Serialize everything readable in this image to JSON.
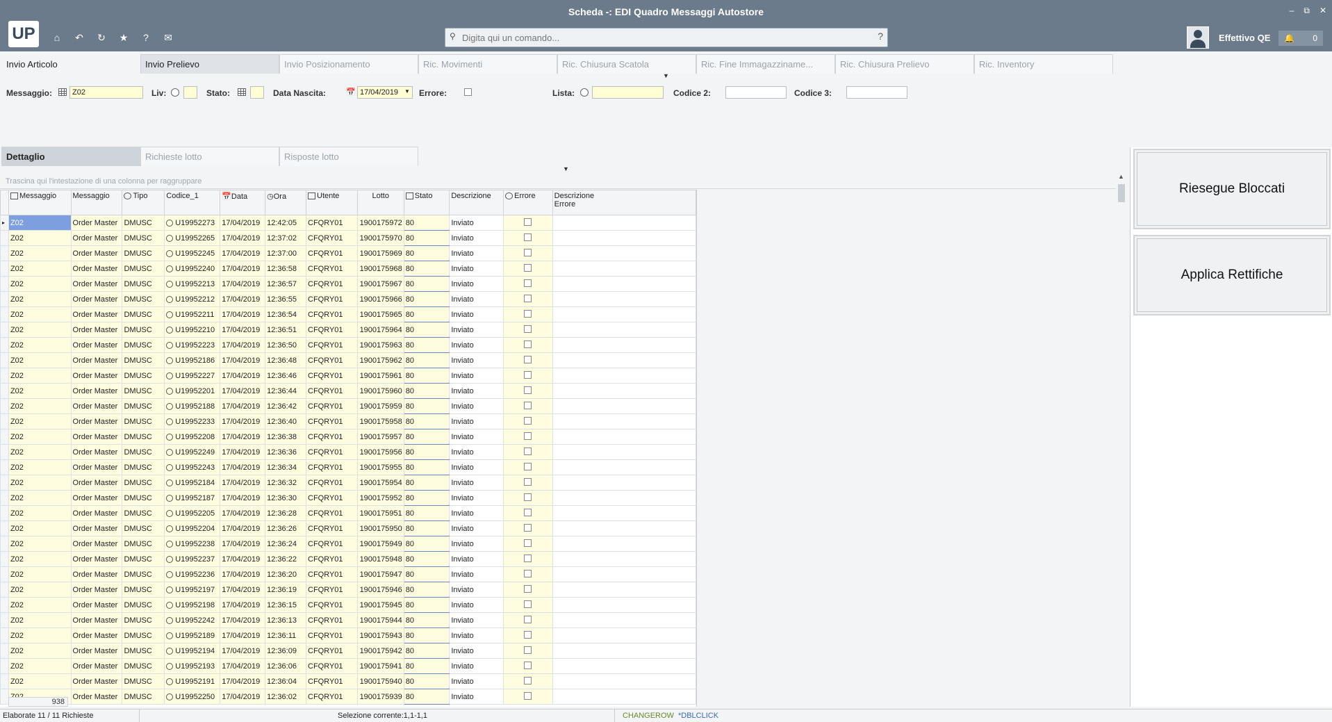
{
  "window": {
    "title": "Scheda -: EDI Quadro Messaggi Autostore",
    "controls": [
      "–",
      "⧉",
      "✕"
    ]
  },
  "header": {
    "logo": "UP",
    "search_placeholder": "Digita qui un comando...",
    "user_name": "Effettivo QE",
    "notifications": "0",
    "nav_icons": [
      "home-icon",
      "undo-icon",
      "refresh-icon",
      "star-icon",
      "help-icon",
      "mail-icon"
    ]
  },
  "tabs_top": [
    "Invio Articolo",
    "Invio Prelievo",
    "Invio Posizionamento",
    "Ric. Movimenti",
    "Ric. Chiusura Scatola",
    "Ric. Fine Immagazziname...",
    "Ric. Chiusura Prelievo",
    "Ric. Inventory"
  ],
  "filters": {
    "messaggio_label": "Messaggio:",
    "messaggio_value": "Z02",
    "liv_label": "Liv:",
    "stato_label": "Stato:",
    "data_label": "Data Nascita:",
    "data_value": "17/04/2019",
    "errore_label": "Errore:",
    "lista_label": "Lista:",
    "codice2_label": "Codice 2:",
    "codice3_label": "Codice 3:"
  },
  "tabs_detail": [
    "Dettaglio",
    "Richieste lotto",
    "Risposte lotto"
  ],
  "group_hint": "Trascina qui l'intestazione di una colonna per raggruppare",
  "columns": [
    "Messaggio",
    "Messaggio",
    "Tipo",
    "Codice_1",
    "Data",
    "Ora",
    "Utente",
    "Lotto",
    "Stato",
    "Descrizione",
    "Errore",
    "Descrizione Errore"
  ],
  "rows": [
    [
      "Z02",
      "Order Master",
      "DMUSC",
      "U19952273",
      "17/04/2019",
      "12:42:05",
      "CFQRY01",
      "1900175972",
      "80",
      "Inviato"
    ],
    [
      "Z02",
      "Order Master",
      "DMUSC",
      "U19952265",
      "17/04/2019",
      "12:37:02",
      "CFQRY01",
      "1900175970",
      "80",
      "Inviato"
    ],
    [
      "Z02",
      "Order Master",
      "DMUSC",
      "U19952245",
      "17/04/2019",
      "12:37:00",
      "CFQRY01",
      "1900175969",
      "80",
      "Inviato"
    ],
    [
      "Z02",
      "Order Master",
      "DMUSC",
      "U19952240",
      "17/04/2019",
      "12:36:58",
      "CFQRY01",
      "1900175968",
      "80",
      "Inviato"
    ],
    [
      "Z02",
      "Order Master",
      "DMUSC",
      "U19952213",
      "17/04/2019",
      "12:36:57",
      "CFQRY01",
      "1900175967",
      "80",
      "Inviato"
    ],
    [
      "Z02",
      "Order Master",
      "DMUSC",
      "U19952212",
      "17/04/2019",
      "12:36:55",
      "CFQRY01",
      "1900175966",
      "80",
      "Inviato"
    ],
    [
      "Z02",
      "Order Master",
      "DMUSC",
      "U19952211",
      "17/04/2019",
      "12:36:54",
      "CFQRY01",
      "1900175965",
      "80",
      "Inviato"
    ],
    [
      "Z02",
      "Order Master",
      "DMUSC",
      "U19952210",
      "17/04/2019",
      "12:36:51",
      "CFQRY01",
      "1900175964",
      "80",
      "Inviato"
    ],
    [
      "Z02",
      "Order Master",
      "DMUSC",
      "U19952223",
      "17/04/2019",
      "12:36:50",
      "CFQRY01",
      "1900175963",
      "80",
      "Inviato"
    ],
    [
      "Z02",
      "Order Master",
      "DMUSC",
      "U19952186",
      "17/04/2019",
      "12:36:48",
      "CFQRY01",
      "1900175962",
      "80",
      "Inviato"
    ],
    [
      "Z02",
      "Order Master",
      "DMUSC",
      "U19952227",
      "17/04/2019",
      "12:36:46",
      "CFQRY01",
      "1900175961",
      "80",
      "Inviato"
    ],
    [
      "Z02",
      "Order Master",
      "DMUSC",
      "U19952201",
      "17/04/2019",
      "12:36:44",
      "CFQRY01",
      "1900175960",
      "80",
      "Inviato"
    ],
    [
      "Z02",
      "Order Master",
      "DMUSC",
      "U19952188",
      "17/04/2019",
      "12:36:42",
      "CFQRY01",
      "1900175959",
      "80",
      "Inviato"
    ],
    [
      "Z02",
      "Order Master",
      "DMUSC",
      "U19952233",
      "17/04/2019",
      "12:36:40",
      "CFQRY01",
      "1900175958",
      "80",
      "Inviato"
    ],
    [
      "Z02",
      "Order Master",
      "DMUSC",
      "U19952208",
      "17/04/2019",
      "12:36:38",
      "CFQRY01",
      "1900175957",
      "80",
      "Inviato"
    ],
    [
      "Z02",
      "Order Master",
      "DMUSC",
      "U19952249",
      "17/04/2019",
      "12:36:36",
      "CFQRY01",
      "1900175956",
      "80",
      "Inviato"
    ],
    [
      "Z02",
      "Order Master",
      "DMUSC",
      "U19952243",
      "17/04/2019",
      "12:36:34",
      "CFQRY01",
      "1900175955",
      "80",
      "Inviato"
    ],
    [
      "Z02",
      "Order Master",
      "DMUSC",
      "U19952184",
      "17/04/2019",
      "12:36:32",
      "CFQRY01",
      "1900175954",
      "80",
      "Inviato"
    ],
    [
      "Z02",
      "Order Master",
      "DMUSC",
      "U19952187",
      "17/04/2019",
      "12:36:30",
      "CFQRY01",
      "1900175952",
      "80",
      "Inviato"
    ],
    [
      "Z02",
      "Order Master",
      "DMUSC",
      "U19952205",
      "17/04/2019",
      "12:36:28",
      "CFQRY01",
      "1900175951",
      "80",
      "Inviato"
    ],
    [
      "Z02",
      "Order Master",
      "DMUSC",
      "U19952204",
      "17/04/2019",
      "12:36:26",
      "CFQRY01",
      "1900175950",
      "80",
      "Inviato"
    ],
    [
      "Z02",
      "Order Master",
      "DMUSC",
      "U19952238",
      "17/04/2019",
      "12:36:24",
      "CFQRY01",
      "1900175949",
      "80",
      "Inviato"
    ],
    [
      "Z02",
      "Order Master",
      "DMUSC",
      "U19952237",
      "17/04/2019",
      "12:36:22",
      "CFQRY01",
      "1900175948",
      "80",
      "Inviato"
    ],
    [
      "Z02",
      "Order Master",
      "DMUSC",
      "U19952236",
      "17/04/2019",
      "12:36:20",
      "CFQRY01",
      "1900175947",
      "80",
      "Inviato"
    ],
    [
      "Z02",
      "Order Master",
      "DMUSC",
      "U19952197",
      "17/04/2019",
      "12:36:19",
      "CFQRY01",
      "1900175946",
      "80",
      "Inviato"
    ],
    [
      "Z02",
      "Order Master",
      "DMUSC",
      "U19952198",
      "17/04/2019",
      "12:36:15",
      "CFQRY01",
      "1900175945",
      "80",
      "Inviato"
    ],
    [
      "Z02",
      "Order Master",
      "DMUSC",
      "U19952242",
      "17/04/2019",
      "12:36:13",
      "CFQRY01",
      "1900175944",
      "80",
      "Inviato"
    ],
    [
      "Z02",
      "Order Master",
      "DMUSC",
      "U19952189",
      "17/04/2019",
      "12:36:11",
      "CFQRY01",
      "1900175943",
      "80",
      "Inviato"
    ],
    [
      "Z02",
      "Order Master",
      "DMUSC",
      "U19952194",
      "17/04/2019",
      "12:36:09",
      "CFQRY01",
      "1900175942",
      "80",
      "Inviato"
    ],
    [
      "Z02",
      "Order Master",
      "DMUSC",
      "U19952193",
      "17/04/2019",
      "12:36:06",
      "CFQRY01",
      "1900175941",
      "80",
      "Inviato"
    ],
    [
      "Z02",
      "Order Master",
      "DMUSC",
      "U19952191",
      "17/04/2019",
      "12:36:04",
      "CFQRY01",
      "1900175940",
      "80",
      "Inviato"
    ],
    [
      "Z02",
      "Order Master",
      "DMUSC",
      "U19952250",
      "17/04/2019",
      "12:36:02",
      "CFQRY01",
      "1900175939",
      "80",
      "Inviato"
    ]
  ],
  "grid_footer_count": "938",
  "buttons": {
    "riesegue": "Riesegue Bloccati",
    "applica": "Applica Rettifiche"
  },
  "status": {
    "elaborate": "Elaborate 11 / 11 Richieste",
    "selezione": "Selezione corrente:1,1-1,1",
    "changerow": "CHANGEROW",
    "dblclick": "*DBLCLICK"
  },
  "colors": {
    "titlebar": "#6b7b8c",
    "yellow_cell": "#fffde0",
    "selection": "#7d9fe0",
    "status_green": "#6a8a2a"
  }
}
